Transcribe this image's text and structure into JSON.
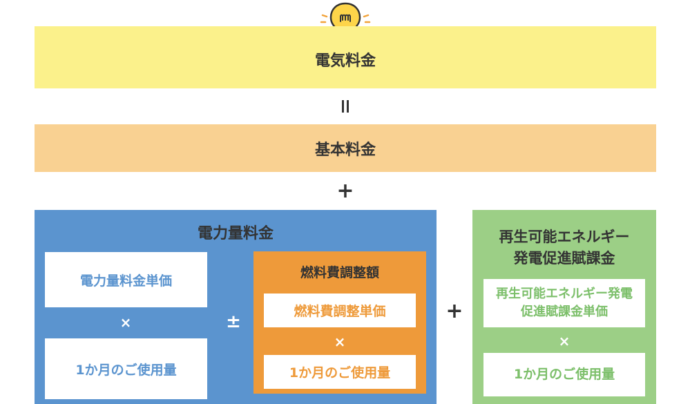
{
  "colors": {
    "yellow": "#fbf18b",
    "peach": "#f9d192",
    "blue": "#5b94cf",
    "orange": "#ee9a3a",
    "green": "#9ccf86",
    "blue_text": "#5b94cf",
    "orange_text": "#ee9a3a",
    "green_text": "#7cbf6a"
  },
  "electricity_bill": "電気料金",
  "equals": "=",
  "basic_fee": "基本料金",
  "plus": "+",
  "energy": {
    "title": "電力量料金",
    "unit_price": "電力量料金単価",
    "times": "×",
    "usage": "1か月のご使用量",
    "plus_minus": "±",
    "fuel": {
      "title": "燃料費調整額",
      "unit_price": "燃料費調整単価",
      "times": "×",
      "usage": "1か月のご使用量"
    }
  },
  "plus2": "+",
  "renewable": {
    "title_line1": "再生可能エネルギー",
    "title_line2": "発電促進賦課金",
    "unit_price_line1": "再生可能エネルギー発電",
    "unit_price_line2": "促進賦課金単価",
    "times": "×",
    "usage": "1か月のご使用量"
  }
}
